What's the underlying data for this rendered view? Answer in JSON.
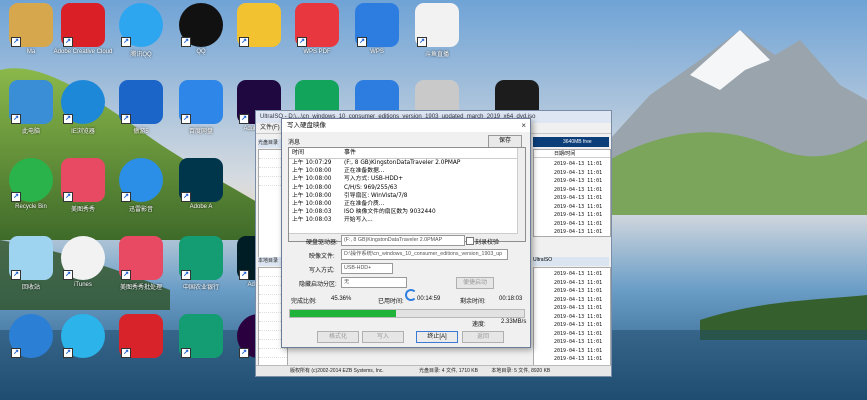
{
  "desktop": {
    "icons": [
      {
        "label": "Ma",
        "icon": "folder-icon",
        "color": "#d6a74d"
      },
      {
        "label": "Adobe Creative Cloud",
        "icon": "adobe-cc-icon",
        "color": "#da1f26"
      },
      {
        "label": "腾讯QQ",
        "icon": "penguin-icon",
        "color": "#2ea6ef"
      },
      {
        "label": "QQ",
        "icon": "qq-icon",
        "color": "#111111"
      },
      {
        "label": "",
        "icon": "file-icon",
        "color": "#f2c230"
      },
      {
        "label": "WPS PDF",
        "icon": "wps-pdf-icon",
        "color": "#e8373e"
      },
      {
        "label": "WPS",
        "icon": "wps-icon",
        "color": "#2d7de0"
      },
      {
        "label": "斗鱼直播",
        "icon": "douyu-icon",
        "color": "#f2f2f2"
      },
      {
        "label": "此电脑",
        "icon": "computer-icon",
        "color": "#3a8ed6"
      },
      {
        "label": "IE浏览器",
        "icon": "ie-icon",
        "color": "#1e88d8"
      },
      {
        "label": "傲游5",
        "icon": "maxthon-icon",
        "color": "#1b64c8"
      },
      {
        "label": "百度网盘",
        "icon": "baidu-cloud-icon",
        "color": "#2e86e8"
      },
      {
        "label": "Adobe After",
        "icon": "after-effects-icon",
        "color": "#1f0740"
      },
      {
        "label": "",
        "icon": "green-s-icon",
        "color": "#11a45a"
      },
      {
        "label": "",
        "icon": "pen-icon",
        "color": "#2d7de0"
      },
      {
        "label": "",
        "icon": "dvd-icon",
        "color": "#c9c9c9"
      },
      {
        "label": "",
        "icon": "terminal-icon",
        "color": "#1c1c1c"
      },
      {
        "label": "Recycle Bin",
        "icon": "sync-icon",
        "color": "#2ab34b"
      },
      {
        "label": "美图秀秀",
        "icon": "meitu-icon",
        "color": "#e84a64"
      },
      {
        "label": "迅雷影音",
        "icon": "play-icon",
        "color": "#2b8fe8"
      },
      {
        "label": "Adobe A",
        "icon": "animate-icon",
        "color": "#00364c"
      },
      {
        "label": "回收站",
        "icon": "recycle-bin-icon",
        "color": "#9fd4f0"
      },
      {
        "label": "iTunes",
        "icon": "itunes-icon",
        "color": "#f2f2f2"
      },
      {
        "label": "美图秀秀批处理",
        "icon": "meitu-batch-icon",
        "color": "#e84a64"
      },
      {
        "label": "中国农业银行",
        "icon": "abc-bank-icon",
        "color": "#149c72"
      },
      {
        "label": "Adobe P",
        "icon": "photoshop-icon",
        "color": "#001d26"
      },
      {
        "label": "",
        "icon": "edge-icon",
        "color": "#2b80d6"
      },
      {
        "label": "",
        "icon": "qq-browser-icon",
        "color": "#2bb3ea"
      },
      {
        "label": "",
        "icon": "red-app-icon",
        "color": "#d8232a"
      },
      {
        "label": "",
        "icon": "bank-icon",
        "color": "#149c72"
      },
      {
        "label": "",
        "icon": "premiere-icon",
        "color": "#2a003f"
      }
    ]
  },
  "bg_window": {
    "title": "UltraISO - D:\\...\\cn_windows_10_consumer_editions_version_1903_updated_march_2019_x64_dvd.iso",
    "menu": "文件(F)",
    "left_head": "光盘目录",
    "left_head2": "本地目录",
    "right_head_size": "3640MB free",
    "right_head_date": "日期/时间",
    "right_head2": "UltraISO",
    "dates_top": [
      "2019-04-13 11:01",
      "2019-04-13 11:01",
      "2019-04-13 11:01",
      "2019-04-13 11:01",
      "2019-04-13 11:01",
      "2019-04-13 11:01",
      "2019-04-13 11:01",
      "2019-04-13 11:01",
      "2019-04-13 11:01"
    ],
    "dates_bottom": [
      "2019-04-13 11:01",
      "2019-04-13 11:01",
      "2019-04-13 11:01",
      "2019-04-13 11:01",
      "2019-04-13 11:01",
      "2019-04-13 11:01",
      "2019-04-13 11:01",
      "2019-04-13 11:01",
      "2019-04-13 11:01",
      "2019-04-13 11:01",
      "2019-04-13 11:01"
    ],
    "status_copyright": "版权所有 (c)2002-2014 EZB Systems, Inc.",
    "status_disc": "光盘目录: 4 文件, 1710 KB",
    "status_local": "本地目录: 5 文件, 8920 KB"
  },
  "dialog": {
    "title": "写入硬盘映像",
    "close": "×",
    "message_label": "消息",
    "save_button": "保存",
    "log_header_time": "时间",
    "log_header_event": "事件",
    "log": [
      {
        "time": "上午 10:07:29",
        "event": "(F:, 8 GB)KingstonDataTraveler 2.0PMAP"
      },
      {
        "time": "上午 10:08:00",
        "event": "正在准备数据..."
      },
      {
        "time": "上午 10:08:00",
        "event": "写入方式: USB-HDD+"
      },
      {
        "time": "上午 10:08:00",
        "event": "C/H/S: 969/255/63"
      },
      {
        "time": "上午 10:08:00",
        "event": "引导扇区: WinVista/7/8"
      },
      {
        "time": "上午 10:08:00",
        "event": "正在准备介质..."
      },
      {
        "time": "上午 10:08:03",
        "event": "ISO 映像文件的扇区数为 9032440"
      },
      {
        "time": "上午 10:08:03",
        "event": "开始写入..."
      }
    ],
    "drive_label": "硬盘驱动器:",
    "drive_value": "(F:, 8 GB)KingstonDataTraveler 2.0PMAP",
    "verify_label": "刻录校验",
    "image_label": "映像文件:",
    "image_value": "D:\\操作系统\\cn_windows_10_consumer_editions_version_1903_up",
    "method_label": "写入方式:",
    "method_value": "USB-HDD+",
    "hide_label": "隐藏启动分区:",
    "hide_value": "无",
    "xboot_button": "便捷启动",
    "done_label": "完成比例:",
    "done_value": "45.36%",
    "elapsed_label": "已用时间:",
    "elapsed_value": "00:14:59",
    "remaining_label": "剩余时间:",
    "remaining_value": "00:18:03",
    "progress": 0.4536,
    "speed_label": "速度:",
    "speed_value": "2.33MB/s",
    "buttons": {
      "format": "格式化",
      "write": "写入",
      "stop": "终止[A]",
      "back": "返回"
    },
    "dots": "..."
  }
}
